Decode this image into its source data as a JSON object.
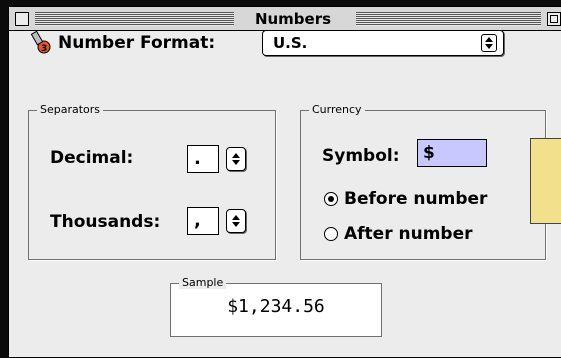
{
  "window": {
    "title": "Numbers"
  },
  "number_format": {
    "label": "Number Format:",
    "value": "U.S."
  },
  "separators": {
    "group_label": "Separators",
    "decimal_label": "Decimal:",
    "decimal_value": ".",
    "thousands_label": "Thousands:",
    "thousands_value": ","
  },
  "currency": {
    "group_label": "Currency",
    "symbol_label": "Symbol:",
    "symbol_value": "$",
    "before_label": "Before number",
    "after_label": "After number",
    "selected": "before"
  },
  "sample": {
    "label": "Sample",
    "value": "$1,234.56"
  },
  "colors": {
    "window_bg": "#ececec",
    "field_highlight": "#c8c8ff",
    "sticky": "#f3e08d"
  },
  "icons": {
    "close": "close-box-icon",
    "zoom": "zoom-box-icon",
    "number_format": "number-format-icon",
    "popup_arrow": "updown-arrows-icon"
  }
}
